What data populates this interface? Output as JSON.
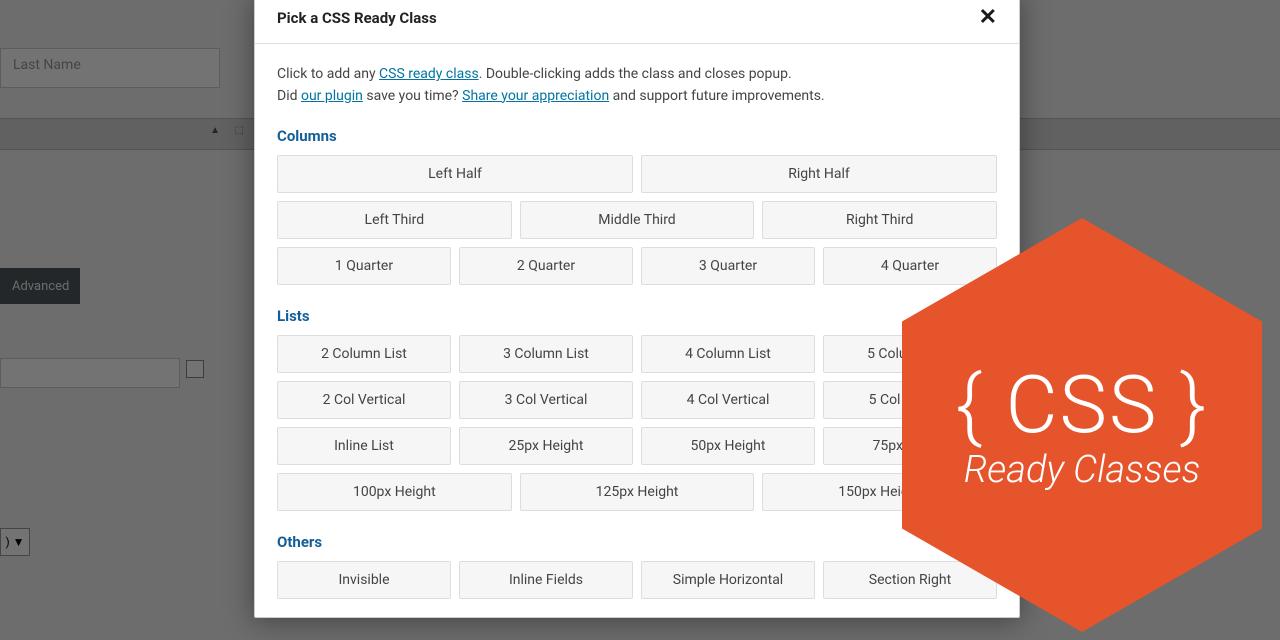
{
  "background": {
    "input_placeholder": "Last Name",
    "advanced_tab": "Advanced",
    "dropdown_suffix": ") ▼"
  },
  "modal": {
    "title": "Pick a CSS Ready Class",
    "intro_text_1": "Click to add any ",
    "link_1": "CSS ready class",
    "intro_text_2": ". Double-clicking adds the class and closes popup.",
    "intro_text_3": "Did ",
    "link_2": "our plugin",
    "intro_text_4": " save you time? ",
    "link_3": "Share your appreciation",
    "intro_text_5": " and support future improvements."
  },
  "sections": {
    "columns": {
      "title": "Columns",
      "row1": [
        "Left Half",
        "Right Half"
      ],
      "row2": [
        "Left Third",
        "Middle Third",
        "Right Third"
      ],
      "row3": [
        "1 Quarter",
        "2 Quarter",
        "3 Quarter",
        "4 Quarter"
      ]
    },
    "lists": {
      "title": "Lists",
      "row1": [
        "2 Column List",
        "3 Column List",
        "4 Column List",
        "5 Column List"
      ],
      "row2": [
        "2 Col Vertical",
        "3 Col Vertical",
        "4 Col Vertical",
        "5 Col Vertical"
      ],
      "row3": [
        "Inline List",
        "25px Height",
        "50px Height",
        "75px Height"
      ],
      "row4": [
        "100px Height",
        "125px Height",
        "150px Height"
      ]
    },
    "others": {
      "title": "Others",
      "row1": [
        "Invisible",
        "Inline Fields",
        "Simple Horizontal",
        "Section Right"
      ]
    }
  },
  "hexagon": {
    "line1": "{ CSS }",
    "line2": "Ready Classes"
  }
}
